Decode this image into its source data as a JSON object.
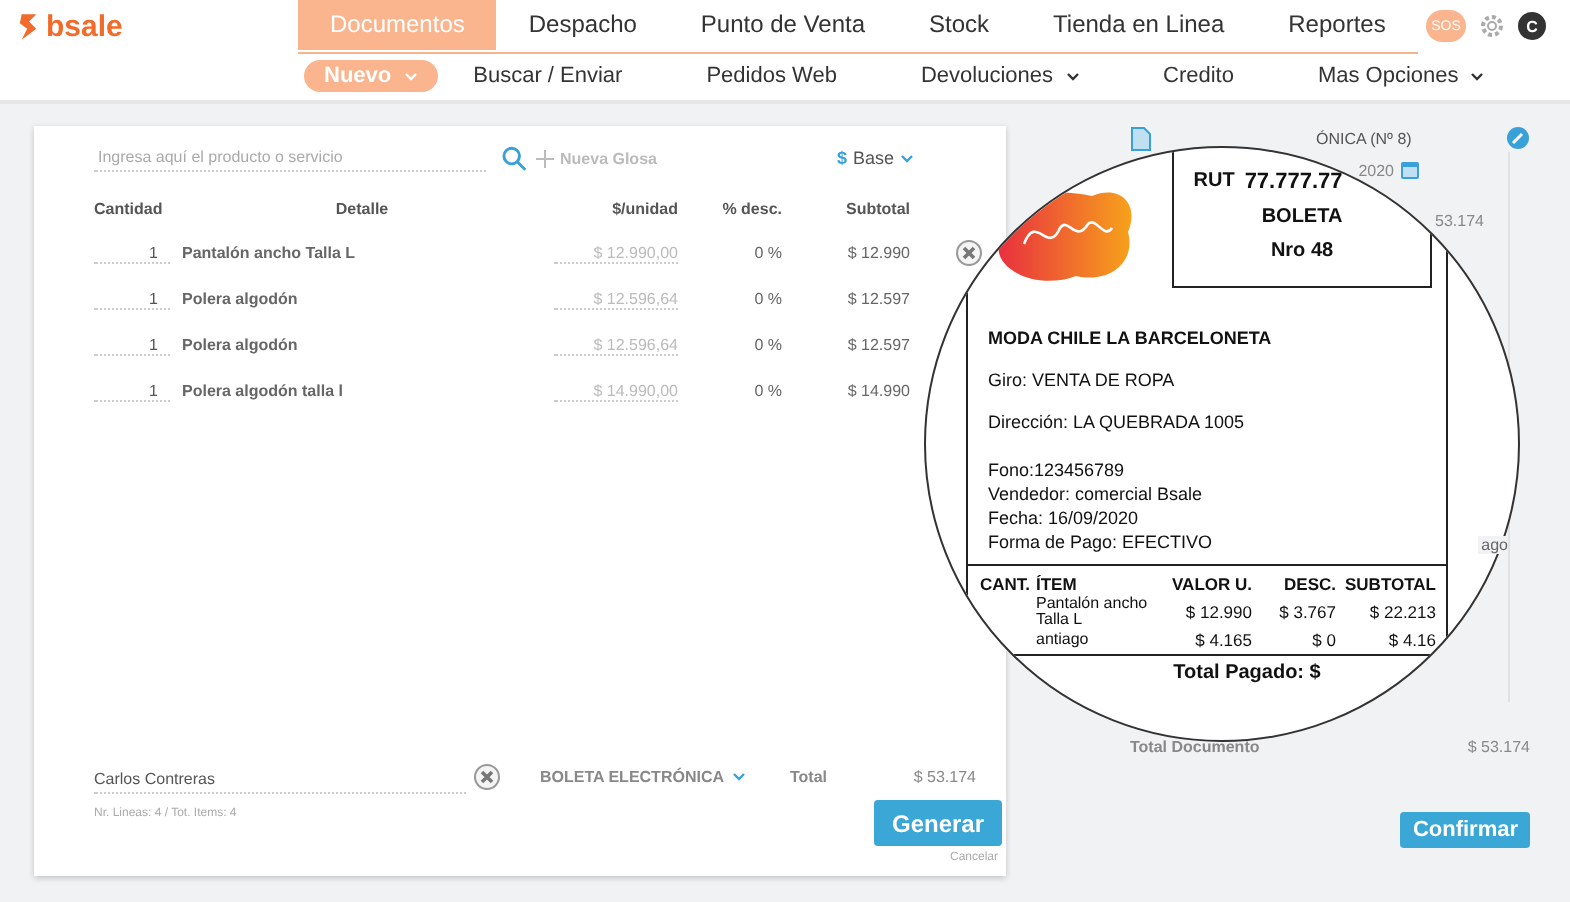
{
  "brand": {
    "name": "bsale"
  },
  "main_nav": [
    {
      "label": "Documentos",
      "selected": true
    },
    {
      "label": "Despacho",
      "selected": false
    },
    {
      "label": "Punto de Venta",
      "selected": false
    },
    {
      "label": "Stock",
      "selected": false
    },
    {
      "label": "Tienda en Linea",
      "selected": false
    },
    {
      "label": "Reportes",
      "selected": false
    }
  ],
  "header_actions": {
    "badge": "SOS",
    "avatar": "C"
  },
  "sub_nav": [
    {
      "label": "Nuevo",
      "selected": true,
      "dropdown": true
    },
    {
      "label": "Buscar / Enviar",
      "selected": false,
      "dropdown": false
    },
    {
      "label": "Pedidos Web",
      "selected": false,
      "dropdown": false
    },
    {
      "label": "Devoluciones",
      "selected": false,
      "dropdown": true
    },
    {
      "label": "Credito",
      "selected": false,
      "dropdown": false
    },
    {
      "label": "Mas Opciones",
      "selected": false,
      "dropdown": true
    }
  ],
  "editor": {
    "search": {
      "placeholder": "Ingresa aquí el producto o servicio"
    },
    "new_gloss": "Nueva Glosa",
    "currency": "$",
    "price_list": "Base",
    "columns": [
      "Cantidad",
      "Detalle",
      "$/unidad",
      "% desc.",
      "Subtotal"
    ],
    "rows": [
      {
        "quantity": "1",
        "detail": "Pantalón ancho Talla L",
        "unit_price": "$ 12.990,00",
        "discount": "0 %",
        "subtotal": "$ 12.990",
        "removable": true
      },
      {
        "quantity": "1",
        "detail": "Polera algodón",
        "unit_price": "$ 12.596,64",
        "discount": "0 %",
        "subtotal": "$ 12.597",
        "removable": false
      },
      {
        "quantity": "1",
        "detail": "Polera algodón",
        "unit_price": "$ 12.596,64",
        "discount": "0 %",
        "subtotal": "$ 12.597",
        "removable": false
      },
      {
        "quantity": "1",
        "detail": "Polera algodón talla l",
        "unit_price": "$ 14.990,00",
        "discount": "0 %",
        "subtotal": "$ 14.990",
        "removable": false
      }
    ],
    "client": "Carlos Contreras",
    "document_type": "BOLETA ELECTRÓNICA",
    "total_label": "Total",
    "total": "$ 53.174",
    "summary": "Nr. Lineas: 4 / Tot. Items: 4",
    "generate": "Generar",
    "cancel": "Cancelar"
  },
  "preview": {
    "title_fragment": "ÓNICA (Nº 8)",
    "date_fragment": "2020",
    "amount_fragment": "53.174",
    "payment_fragment": "ago",
    "total_label": "Total Documento",
    "total": "$ 53.174",
    "confirm": "Confirmar"
  },
  "magnifier": {
    "rut_label": "RUT",
    "rut": "77.777.77",
    "doc_type": "BOLETA",
    "number": "Nro 48",
    "company": "MODA CHILE LA BARCELONETA",
    "giro": "Giro: VENTA DE ROPA",
    "address": "Dirección: LA QUEBRADA 1005",
    "details": [
      "Fono:123456789",
      "Vendedor: comercial Bsale",
      "Fecha: 16/09/2020",
      "Forma de Pago: EFECTIVO"
    ],
    "columns": [
      "CANT.",
      "ÍTEM",
      "VALOR U.",
      "DESC.",
      "SUBTOTAL"
    ],
    "rows": [
      {
        "item": "Pantalón ancho Talla L",
        "unit": "$ 12.990",
        "discount": "$ 3.767",
        "subtotal": "$ 22.213"
      },
      {
        "item": "antiago",
        "unit": "$ 4.165",
        "discount": "$ 0",
        "subtotal": "$ 4.16"
      }
    ],
    "total": "Total Pagado: $"
  }
}
